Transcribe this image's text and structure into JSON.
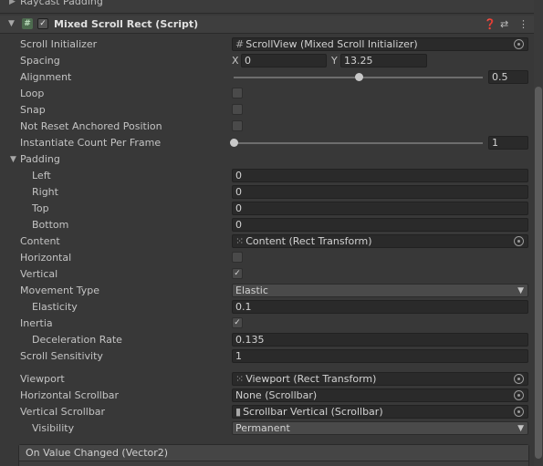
{
  "top_strip": {
    "label": "Raycast Padding"
  },
  "component": {
    "title": "Mixed Scroll Rect (Script)",
    "enabled_mark": "✓",
    "icons": [
      "help-icon",
      "presets-icon",
      "more-icon"
    ]
  },
  "fields": {
    "scroll_initializer": {
      "label": "Scroll Initializer",
      "value": "ScrollView (Mixed Scroll Initializer)"
    },
    "spacing": {
      "label": "Spacing",
      "x_label": "X",
      "x": "0",
      "y_label": "Y",
      "y": "13.25"
    },
    "alignment": {
      "label": "Alignment",
      "value": "0.5",
      "fraction": 0.5
    },
    "loop": {
      "label": "Loop",
      "checked": false
    },
    "snap": {
      "label": "Snap",
      "checked": false
    },
    "not_reset": {
      "label": "Not Reset Anchored Position",
      "checked": false
    },
    "instantiate": {
      "label": "Instantiate Count Per Frame",
      "value": "1",
      "fraction": 0.0
    },
    "padding": {
      "label": "Padding",
      "left_label": "Left",
      "left": "0",
      "right_label": "Right",
      "right": "0",
      "top_label": "Top",
      "top": "0",
      "bottom_label": "Bottom",
      "bottom": "0"
    },
    "content": {
      "label": "Content",
      "value": "Content (Rect Transform)"
    },
    "horizontal": {
      "label": "Horizontal",
      "checked": false
    },
    "vertical": {
      "label": "Vertical",
      "checked": true,
      "mark": "✓"
    },
    "movement_type": {
      "label": "Movement Type",
      "value": "Elastic"
    },
    "elasticity": {
      "label": "Elasticity",
      "value": "0.1"
    },
    "inertia": {
      "label": "Inertia",
      "checked": true,
      "mark": "✓"
    },
    "deceleration": {
      "label": "Deceleration Rate",
      "value": "0.135"
    },
    "scroll_sensitivity": {
      "label": "Scroll Sensitivity",
      "value": "1"
    },
    "viewport": {
      "label": "Viewport",
      "value": "Viewport (Rect Transform)"
    },
    "h_scrollbar": {
      "label": "Horizontal Scrollbar",
      "value": "None (Scrollbar)"
    },
    "v_scrollbar": {
      "label": "Vertical Scrollbar",
      "value": "Scrollbar Vertical (Scrollbar)"
    },
    "visibility": {
      "label": "Visibility",
      "value": "Permanent"
    }
  },
  "events": {
    "label": "On Value Changed (Vector2)"
  }
}
